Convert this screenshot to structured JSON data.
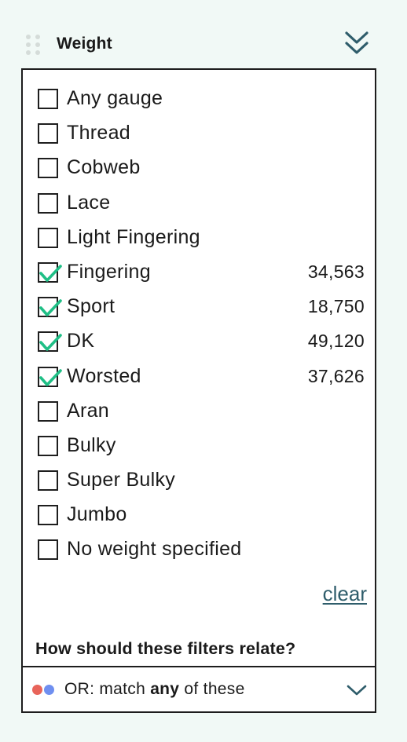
{
  "header": {
    "title": "Weight",
    "drag_icon": "drag-handle-icon",
    "collapse_icon": "double-chevron-down-icon"
  },
  "colors": {
    "background": "#f1f9f6",
    "check": "#1fbf86",
    "link": "#2f5d6b",
    "dot_red": "#e8645a",
    "dot_blue": "#6f8ff0",
    "chevron": "#2f5d6b"
  },
  "weights": [
    {
      "label": "Any gauge",
      "checked": false,
      "count": ""
    },
    {
      "label": "Thread",
      "checked": false,
      "count": ""
    },
    {
      "label": "Cobweb",
      "checked": false,
      "count": ""
    },
    {
      "label": "Lace",
      "checked": false,
      "count": ""
    },
    {
      "label": "Light Fingering",
      "checked": false,
      "count": ""
    },
    {
      "label": "Fingering",
      "checked": true,
      "count": "34,563"
    },
    {
      "label": "Sport",
      "checked": true,
      "count": "18,750"
    },
    {
      "label": "DK",
      "checked": true,
      "count": "49,120"
    },
    {
      "label": "Worsted",
      "checked": true,
      "count": "37,626"
    },
    {
      "label": "Aran",
      "checked": false,
      "count": ""
    },
    {
      "label": "Bulky",
      "checked": false,
      "count": ""
    },
    {
      "label": "Super Bulky",
      "checked": false,
      "count": ""
    },
    {
      "label": "Jumbo",
      "checked": false,
      "count": ""
    },
    {
      "label": "No weight specified",
      "checked": false,
      "count": ""
    }
  ],
  "clear_label": "clear",
  "relate": {
    "question": "How should these filters relate?",
    "selected_prefix": "OR: match ",
    "selected_emphasis": "any",
    "selected_suffix": " of these"
  }
}
